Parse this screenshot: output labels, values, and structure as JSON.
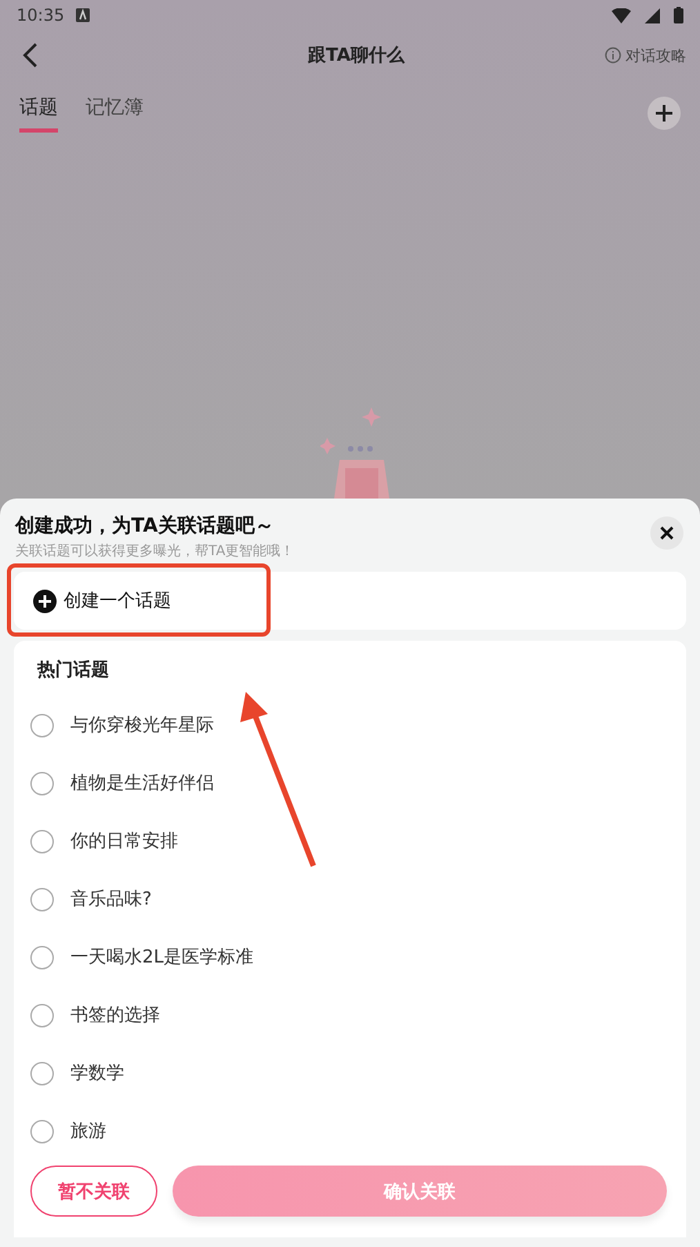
{
  "status_bar": {
    "time": "10:35"
  },
  "header": {
    "title": "跟TA聊什么",
    "guide": "对话攻略"
  },
  "tabs": [
    {
      "label": "话题",
      "selected": true
    },
    {
      "label": "记忆簿",
      "selected": false
    }
  ],
  "sheet": {
    "title": "创建成功，为TA关联话题吧～",
    "subtitle": "关联话题可以获得更多曝光，帮TA更智能哦！",
    "create_label": "创建一个话题",
    "section_title": "热门话题",
    "topics": [
      {
        "label": "与你穿梭光年星际",
        "selected": false
      },
      {
        "label": "植物是生活好伴侣",
        "selected": false
      },
      {
        "label": "你的日常安排",
        "selected": false
      },
      {
        "label": "音乐品味?",
        "selected": false
      },
      {
        "label": "一天喝水2L是医学标准",
        "selected": false
      },
      {
        "label": "书签的选择",
        "selected": false
      },
      {
        "label": "学数学",
        "selected": false
      },
      {
        "label": "旅游",
        "selected": false
      }
    ],
    "skip_button": "暂不关联",
    "confirm_button": {
      "label": "确认关联",
      "disabled": true
    }
  }
}
